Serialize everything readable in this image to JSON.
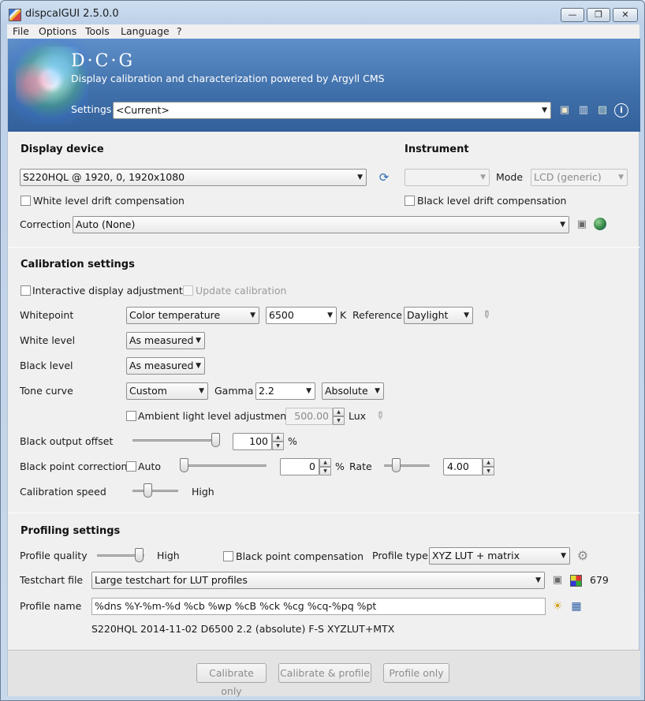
{
  "window": {
    "title": "dispcalGUI 2.5.0.0",
    "minimize": "—",
    "maximize": "❐",
    "close": "✕"
  },
  "menu": {
    "items": [
      "File",
      "Options",
      "Tools",
      "Language",
      "?"
    ]
  },
  "banner": {
    "title": "D·C·G",
    "subtitle": "Display calibration and characterization powered by Argyll CMS",
    "settings_label": "Settings",
    "settings_value": "<Current>"
  },
  "display": {
    "section": "Display device",
    "device": "S220HQL @ 1920, 0, 1920x1080",
    "white_drift": "White level drift compensation",
    "correction_label": "Correction",
    "correction_value": "Auto (None)"
  },
  "instrument": {
    "section": "Instrument",
    "value": "",
    "mode_label": "Mode",
    "mode_value": "LCD (generic)",
    "black_drift": "Black level drift compensation"
  },
  "calibration": {
    "section": "Calibration settings",
    "interactive": "Interactive display adjustment",
    "update": "Update calibration",
    "whitepoint_label": "Whitepoint",
    "whitepoint_mode": "Color temperature",
    "whitepoint_value": "6500",
    "kelvin": "K",
    "reference_label": "Reference",
    "reference_value": "Daylight",
    "white_level_label": "White level",
    "white_level_value": "As measured",
    "black_level_label": "Black level",
    "black_level_value": "As measured",
    "tone_curve_label": "Tone curve",
    "tone_curve_value": "Custom",
    "gamma_label": "Gamma",
    "gamma_value": "2.2",
    "gamma_type": "Absolute",
    "ambient_label": "Ambient light level adjustment",
    "ambient_value": "500.00",
    "lux": "Lux",
    "black_offset_label": "Black output offset",
    "black_offset_value": "100",
    "percent": "%",
    "black_offset_level": 1.0,
    "bpc_label": "Black point correction",
    "bpc_auto": "Auto",
    "bpc_value": "0",
    "bpc_level": 0.0,
    "rate_label": "Rate",
    "rate_value": "4.00",
    "speed_label": "Calibration speed",
    "speed_value": "High"
  },
  "profiling": {
    "section": "Profiling settings",
    "quality_label": "Profile quality",
    "quality_value": "High",
    "bpc": "Black point compensation",
    "type_label": "Profile type",
    "type_value": "XYZ LUT + matrix",
    "testchart_label": "Testchart file",
    "testchart_value": "Large testchart for LUT profiles",
    "testchart_count": "679",
    "name_label": "Profile name",
    "name_value": "%dns %Y-%m-%d %cb %wp %cB %ck %cg %cq-%pq %pt",
    "name_preview": "S220HQL 2014-11-02 D6500 2.2 (absolute) F-S XYZLUT+MTX"
  },
  "footer": {
    "calibrate_only": "Calibrate only",
    "calibrate_profile": "Calibrate & profile",
    "profile_only": "Profile only"
  },
  "icons": [
    "folder-icon",
    "trash-icon",
    "image-icon",
    "info-icon",
    "refresh-icon",
    "globe-icon",
    "eyedropper-icon",
    "gear-icon",
    "lightbulb-icon",
    "save-icon",
    "color-chart-icon"
  ]
}
